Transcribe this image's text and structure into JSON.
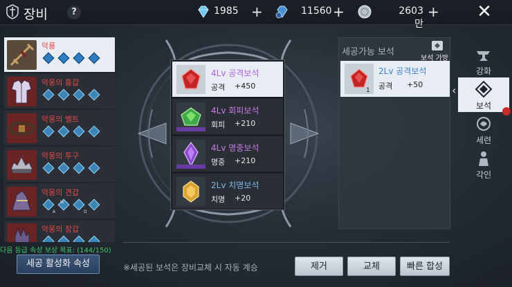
{
  "header": {
    "title": "장비",
    "help_label": "?",
    "close_label": "✕"
  },
  "currencies": [
    {
      "icon": "diamond-icon",
      "value": "1985"
    },
    {
      "icon": "bound-diamond-icon",
      "value": "11560"
    },
    {
      "icon": "silver-coin-icon",
      "value": "2603만"
    }
  ],
  "equipment": [
    {
      "name": "악룡",
      "slots": 4,
      "selected": true
    },
    {
      "name": "악몽의 흉갑",
      "slots": 4,
      "selected": false
    },
    {
      "name": "악몽의 벨트",
      "slots": 4,
      "selected": false
    },
    {
      "name": "악몽의 투구",
      "slots": 4,
      "selected": false
    },
    {
      "name": "악몽의 견갑",
      "slots": 4,
      "selected": false,
      "letters": [
        "A",
        "W",
        "D"
      ]
    },
    {
      "name": "악몽의 장갑",
      "slots": 4,
      "selected": false
    }
  ],
  "progress_text": "다음 등급 속성 보상 목표: (144/150)",
  "activate_button": "세공 활성화 속성",
  "socketed_gems": [
    {
      "name": "4Lv 공격보석",
      "stat": "공격",
      "value": "+450",
      "color": "#b060e0",
      "gem": "red",
      "selected": true
    },
    {
      "name": "4Lv 회피보석",
      "stat": "회피",
      "value": "+210",
      "color": "#c77be8",
      "gem": "green",
      "selected": false
    },
    {
      "name": "4Lv 명중보석",
      "stat": "명중",
      "value": "+210",
      "color": "#c77be8",
      "gem": "purple",
      "selected": false
    },
    {
      "name": "2Lv 치명보석",
      "stat": "치명",
      "value": "+20",
      "color": "#7eb6e8",
      "gem": "yellow",
      "selected": false
    }
  ],
  "available": {
    "title": "세공가능 보석",
    "carry_label": "보석 가방",
    "items": [
      {
        "name": "2Lv 공격보석",
        "stat": "공격",
        "value": "+50",
        "qty": "1"
      }
    ]
  },
  "tabs": [
    {
      "label": "강화",
      "icon": "anvil-icon",
      "selected": false
    },
    {
      "label": "보석",
      "icon": "gem-socket-icon",
      "selected": true
    },
    {
      "label": "세련",
      "icon": "refine-icon",
      "selected": false
    },
    {
      "label": "각인",
      "icon": "engrave-icon",
      "selected": false
    }
  ],
  "notice": "※세공된 보석은 장비교체 시 자동 계승",
  "buttons": {
    "remove": "제거",
    "swap": "교체",
    "quick": "빠른 합성"
  }
}
